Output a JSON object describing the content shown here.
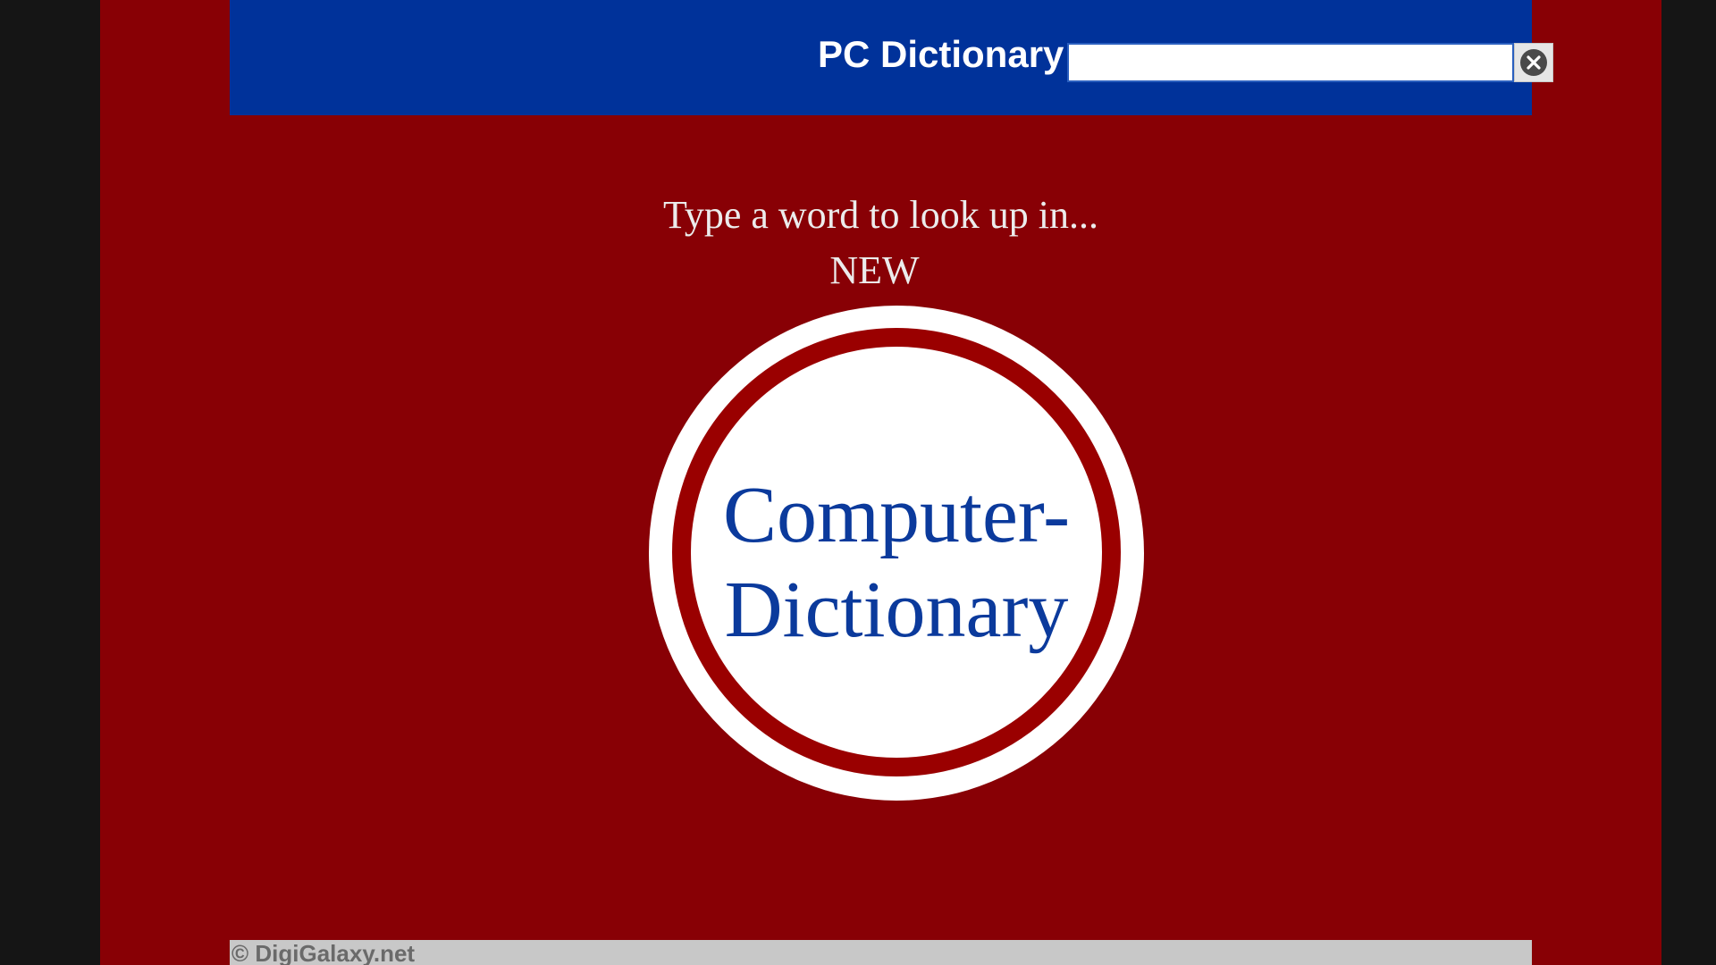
{
  "header": {
    "title": "PC Dictionary",
    "search": {
      "value": "",
      "placeholder": ""
    },
    "clear_icon": "close-circle-icon"
  },
  "main": {
    "prompt_line1": "Type a word to look up in...",
    "prompt_line2": "NEW",
    "logo": {
      "line1": "Computer-",
      "line2": "Dictionary"
    }
  },
  "footer": {
    "copyright": "© DigiGalaxy.net"
  },
  "colors": {
    "page_background": "#880005",
    "header_background": "#00329a",
    "logo_ring": "#9a0000",
    "logo_text": "#0b3a9c",
    "side_background": "#151515"
  }
}
